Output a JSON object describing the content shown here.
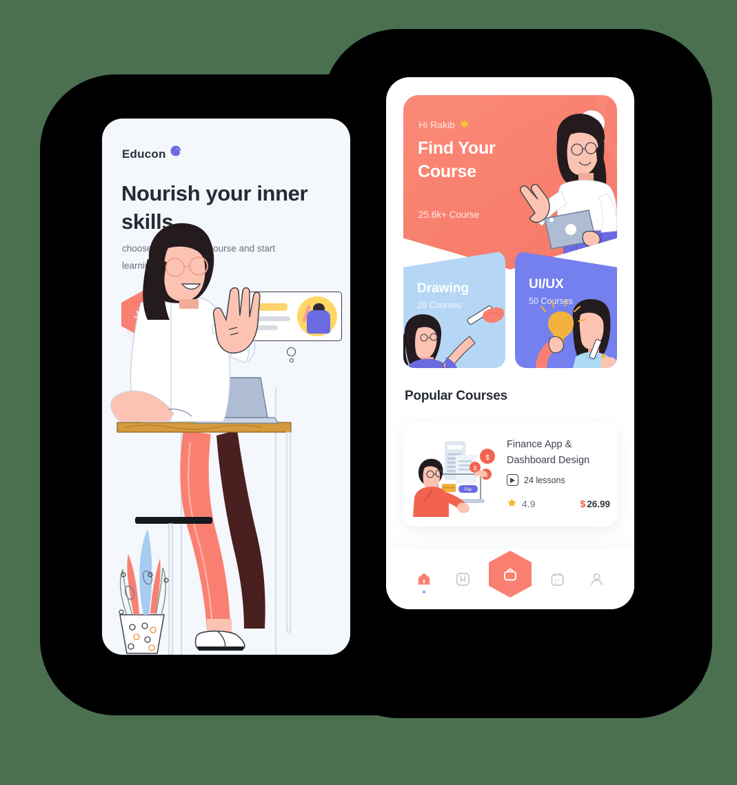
{
  "background": {
    "canvas_color": "#4a7050",
    "blob_color": "#000000"
  },
  "theme": {
    "coral": "#f98071",
    "purple": "#7480ee",
    "light_blue": "#b5d7f5",
    "price_red": "#f2563d",
    "star_yellow": "#f7b731",
    "ink": "#262a35"
  },
  "onboarding_screen": {
    "brand": {
      "name": "Educon",
      "mark_icon": "moon-circle-logo-icon"
    },
    "headline": "Nourish your inner skills",
    "subline": "choose your favorite course and start learning.",
    "join_button": {
      "label": "Join",
      "shape": "hexagon"
    },
    "illustration": {
      "name": "woman-at-desk-with-laptop-illustration",
      "video_card": "lesson-preview-card",
      "plant": "potted-plant-illustration"
    }
  },
  "home_screen": {
    "hero": {
      "greeting": "Hi Rakib",
      "greeting_icon": "waving-hand-emoji",
      "title": "Find Your Course",
      "course_count": "25.6k+ Course",
      "search_icon": "search-icon",
      "illustration": "woman-pointing-with-tablet-illustration"
    },
    "categories": [
      {
        "title": "Drawing",
        "subtitle": "26 Courses",
        "color": "#b5d7f5",
        "illustration": "girl-with-paintbrush-illustration"
      },
      {
        "title": "UI/UX",
        "subtitle": "50 Courses",
        "color": "#7480ee",
        "illustration": "two-women-with-lightbulb-illustration"
      }
    ],
    "popular": {
      "section_title": "Popular Courses",
      "course": {
        "title": "Finance App & Dashboard Design",
        "lessons": "24 lessons",
        "lessons_icon": "play-button-icon",
        "rating": "4.9",
        "rating_icon": "star-icon",
        "currency": "$",
        "price": "26.99",
        "thumbnail": "man-holding-laptop-with-finance-illustration"
      }
    },
    "bottom_nav": [
      {
        "icon": "home-icon",
        "active": true
      },
      {
        "icon": "bookmark-icon",
        "active": false
      },
      {
        "icon": "shopping-bag-icon",
        "active": false,
        "featured": true
      },
      {
        "icon": "calendar-icon",
        "active": false
      },
      {
        "icon": "profile-icon",
        "active": false
      }
    ]
  }
}
